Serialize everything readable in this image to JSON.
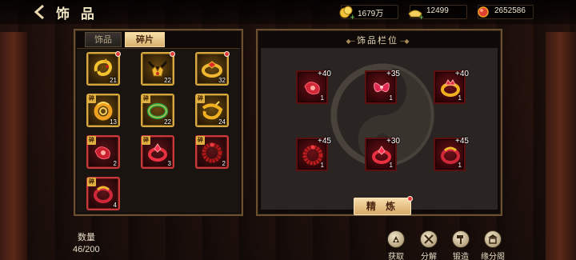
{
  "header": {
    "title": "饰 品",
    "back_icon": "back-arrow-icon"
  },
  "currencies": [
    {
      "name": "gold",
      "icon": "gold-coin-icon",
      "value": "1679万",
      "color": "#f2c23a"
    },
    {
      "name": "ingot",
      "icon": "ingot-icon",
      "value": "12499",
      "color": "#f4d060"
    },
    {
      "name": "gem",
      "icon": "red-gem-icon",
      "value": "2652586",
      "color": "#e04030"
    }
  ],
  "inventory": {
    "tabs": [
      {
        "label": "饰品",
        "active": false
      },
      {
        "label": "碎片",
        "active": true
      }
    ],
    "fragment_badge": "碎",
    "items": [
      {
        "icon": "golden-dragon-ring-icon",
        "rarity": "gold",
        "count": "21",
        "fragment": false,
        "alert": true
      },
      {
        "icon": "golden-crown-necklace-icon",
        "rarity": "gold",
        "count": "22",
        "fragment": false,
        "alert": true
      },
      {
        "icon": "golden-ruby-ring-icon",
        "rarity": "gold",
        "count": "32",
        "fragment": false,
        "alert": true
      },
      {
        "icon": "golden-spiral-ring-icon",
        "rarity": "gold",
        "count": "13",
        "fragment": true,
        "alert": false
      },
      {
        "icon": "jade-bracelet-icon",
        "rarity": "gold",
        "count": "22",
        "fragment": true,
        "alert": false
      },
      {
        "icon": "golden-twist-ring-icon",
        "rarity": "gold",
        "count": "24",
        "fragment": true,
        "alert": false
      },
      {
        "icon": "red-pendant-icon",
        "rarity": "red",
        "count": "2",
        "fragment": true,
        "alert": false
      },
      {
        "icon": "red-gem-ring-icon",
        "rarity": "red",
        "count": "3",
        "fragment": true,
        "alert": false
      },
      {
        "icon": "red-beaded-ring-icon",
        "rarity": "red",
        "count": "2",
        "fragment": true,
        "alert": false
      },
      {
        "icon": "red-gold-ring-icon",
        "rarity": "red",
        "count": "4",
        "fragment": true,
        "alert": false
      }
    ]
  },
  "slots": {
    "title": "饰品栏位",
    "items": [
      {
        "icon": "red-pendant-icon",
        "plus": "+40",
        "level": "1"
      },
      {
        "icon": "red-butterfly-ornament-icon",
        "plus": "+35",
        "level": "1"
      },
      {
        "icon": "red-crown-ring-icon",
        "plus": "+40",
        "level": "1"
      },
      {
        "icon": "red-beaded-ring-icon",
        "plus": "+45",
        "level": "1"
      },
      {
        "icon": "red-gem-ring-icon",
        "plus": "+30",
        "level": "1"
      },
      {
        "icon": "red-gold-ring-icon",
        "plus": "+45",
        "level": "1"
      }
    ],
    "refine_label": "精 炼"
  },
  "footer": {
    "count_label": "数量",
    "count_value": "46/200",
    "actions": [
      {
        "label": "获取",
        "icon": "obtain-icon"
      },
      {
        "label": "分解",
        "icon": "decompose-icon"
      },
      {
        "label": "锻造",
        "icon": "forge-hammer-icon"
      },
      {
        "label": "缘分阁",
        "icon": "pavilion-icon"
      }
    ]
  },
  "colors": {
    "gold_frame": "#d8a840",
    "red_frame": "#c83838",
    "accent_button": "#f6dcaa",
    "alert_dot": "#e43a3a"
  }
}
